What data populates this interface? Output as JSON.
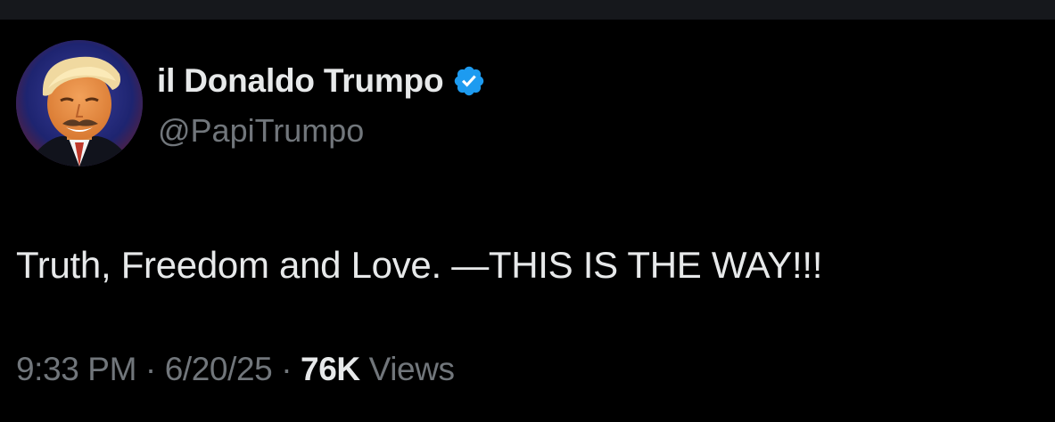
{
  "author": {
    "display_name": "il Donaldo Trumpo",
    "handle": "@PapiTrumpo",
    "verified_icon": "verified-badge-icon",
    "avatar": "profile-photo"
  },
  "tweet": {
    "text": "Truth, Freedom and Love. —THIS IS THE WAY!!!"
  },
  "meta": {
    "time": "9:33 PM",
    "separator": " · ",
    "date": "6/20/25",
    "views_count": "76K",
    "views_label": "Views"
  },
  "colors": {
    "background": "#000000",
    "primary_text": "#e7e9ea",
    "secondary_text": "#71767b",
    "verified_blue": "#1d9bf0"
  }
}
